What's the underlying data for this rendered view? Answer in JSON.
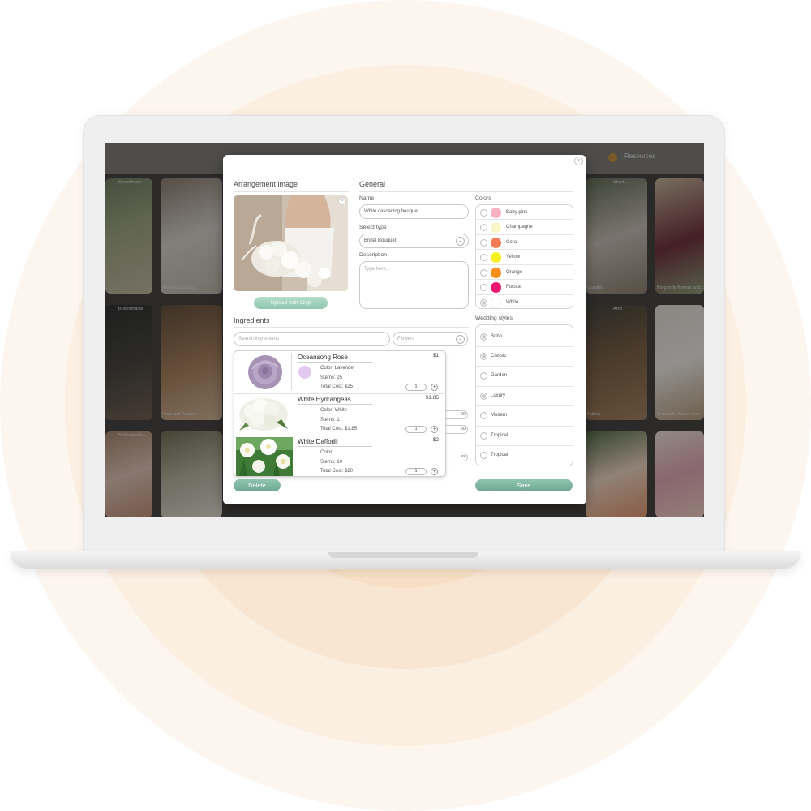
{
  "background_screen": {
    "resources_label": "Resources",
    "tile_captions": [
      "Sweetheart...",
      "White cascading...",
      "Bridesmaids",
      "Rust and Peach...",
      "Bridesmaids...",
      "Short...",
      "Candles",
      "Burgundy flowers and...",
      "Arch",
      "Tables",
      "Terracotta flower with..."
    ]
  },
  "modal": {
    "arrangement_title": "Arrangement image",
    "upload_button": "Upload with Crop",
    "general_title": "General",
    "name_label": "Name",
    "name_value": "White cascading bouquet",
    "type_label": "Select type",
    "type_value": "Bridal Bouquet",
    "description_label": "Description",
    "description_placeholder": "Type here...",
    "colors_title": "Colors",
    "colors": [
      {
        "label": "Baby pink",
        "hex": "#f5b2c0",
        "checked": false
      },
      {
        "label": "Champagne",
        "hex": "#fbf6c9",
        "checked": false
      },
      {
        "label": "Coral",
        "hex": "#f47c52",
        "checked": false
      },
      {
        "label": "Yellow",
        "hex": "#f6ee20",
        "checked": false
      },
      {
        "label": "Orange",
        "hex": "#f68f1e",
        "checked": false
      },
      {
        "label": "Fucsia",
        "hex": "#e8166f",
        "checked": false
      },
      {
        "label": "White",
        "hex": "#ffffff",
        "checked": true
      }
    ],
    "ingredients_title": "Ingredients",
    "search_placeholder": "Search ingredients",
    "category_value": "Flowers",
    "ingredients": [
      {
        "name": "Oceansong Rose",
        "price": "$1",
        "color": "Color: Lavender",
        "stems": "Stems: 25",
        "total": "Total Cost: $25",
        "qty": "1",
        "dot": "#e3c8f2"
      },
      {
        "name": "White Hydrangeas",
        "price": "$1.85",
        "color": "Color: White",
        "stems": "Stems: 1",
        "total": "Total Cost: $1.85",
        "qty": "1"
      },
      {
        "name": "White Daffodil",
        "price": "$2",
        "color": "Color:",
        "stems": "Stems: 10",
        "total": "Total Cost: $20",
        "qty": "1"
      }
    ],
    "behind_values": [
      "00",
      "50",
      "es"
    ],
    "wedding_styles_title": "Wedding styles",
    "wedding_styles": [
      {
        "label": "Boho",
        "checked": true
      },
      {
        "label": "Classic",
        "checked": true
      },
      {
        "label": "Garden",
        "checked": false
      },
      {
        "label": "Luxury",
        "checked": true
      },
      {
        "label": "Modern",
        "checked": false
      },
      {
        "label": "Tropical",
        "checked": false
      },
      {
        "label": "Tropical",
        "checked": false
      }
    ],
    "delete_button": "Delete",
    "save_button": "Save"
  }
}
